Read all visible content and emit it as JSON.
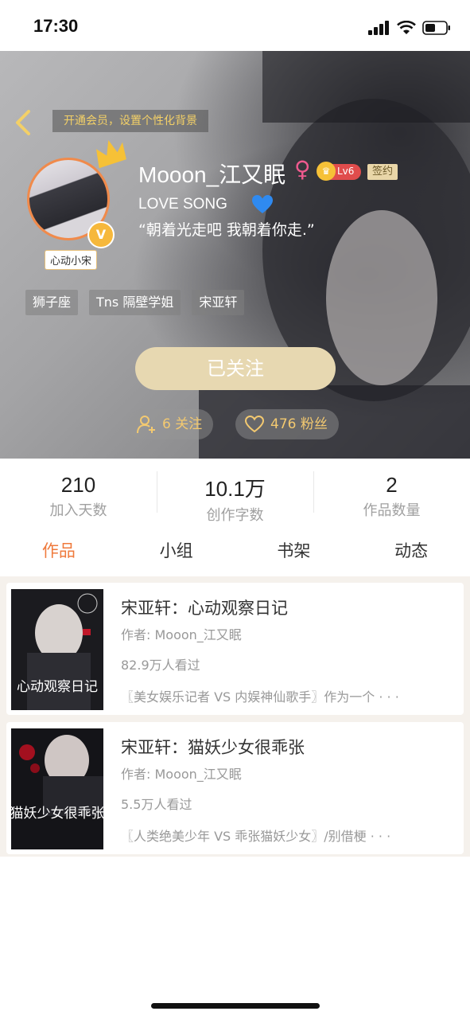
{
  "status_bar": {
    "time": "17:30"
  },
  "header": {
    "vip_hint": "开通会员，设置个性化背景",
    "avatar_tag": "心动小宋",
    "avatar_badge": "V",
    "username": "Mooon_江又眠",
    "gender_symbol": "♀",
    "level": "Lv6",
    "sign_badge": "签约",
    "bio_line1": "LOVE  SONG",
    "bio_line2": "“朝着光走吧 我朝着你走.”",
    "tags": [
      "狮子座",
      "Tns 隔壁学姐",
      "宋亚轩"
    ],
    "follow_button": "已关注",
    "following": "6 关注",
    "fans": "476 粉丝"
  },
  "stats": [
    {
      "value": "210",
      "label": "加入天数"
    },
    {
      "value": "10.1万",
      "label": "创作字数"
    },
    {
      "value": "2",
      "label": "作品数量"
    }
  ],
  "tabs": [
    "作品",
    "小组",
    "书架",
    "动态"
  ],
  "active_tab": "作品",
  "works": [
    {
      "title": "宋亚轩：心动观察日记",
      "author": "作者: Mooon_江又眠",
      "views": "82.9万人看过",
      "desc": "〖美女娱乐记者 VS 内娱神仙歌手〗作为一个 · · ·",
      "cover_title": "心动观察日记"
    },
    {
      "title": "宋亚轩：猫妖少女很乖张",
      "author": "作者: Mooon_江又眠",
      "views": "5.5万人看过",
      "desc": "〖人类绝美少年 VS 乖张猫妖少女〗/别借梗 · · ·",
      "cover_title": "猫妖少女很乖张"
    }
  ],
  "colors": {
    "accent": "#ef7a3c",
    "follow_button": "#e7d8b1",
    "level_badge": "#e04c4c",
    "gold": "#f3c970"
  }
}
